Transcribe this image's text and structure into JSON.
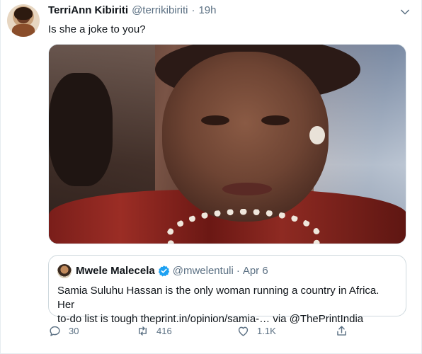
{
  "tweet": {
    "author_name": "TerriAnn Kibiriti",
    "author_handle": "@terrikibiriti",
    "separator": "·",
    "time": "19h",
    "text": "Is she a joke to you?"
  },
  "quoted_tweet": {
    "author_name": "Mwele Malecela",
    "author_handle": "@mwelentuli",
    "separator": "·",
    "date": "Apr 6",
    "text_line1": "Samia Suluhu Hassan is the only woman running a country in Africa. Her",
    "text_line2_prefix": "to-do list is tough ",
    "link_text": "theprint.in/opinion/samia-…",
    "text_line2_suffix": " via ",
    "mention": "@ThePrintIndia"
  },
  "actions": {
    "replies": "30",
    "retweets": "416",
    "likes": "1.1K"
  },
  "icons": {
    "more": "chevron-down-icon",
    "verified": "verified-badge-icon",
    "reply": "reply-icon",
    "retweet": "retweet-icon",
    "like": "heart-icon",
    "share": "share-icon"
  },
  "colors": {
    "text_primary": "#0f1419",
    "text_secondary": "#5b7083",
    "verified_blue": "#1da1f2",
    "border": "#cfd9de"
  }
}
